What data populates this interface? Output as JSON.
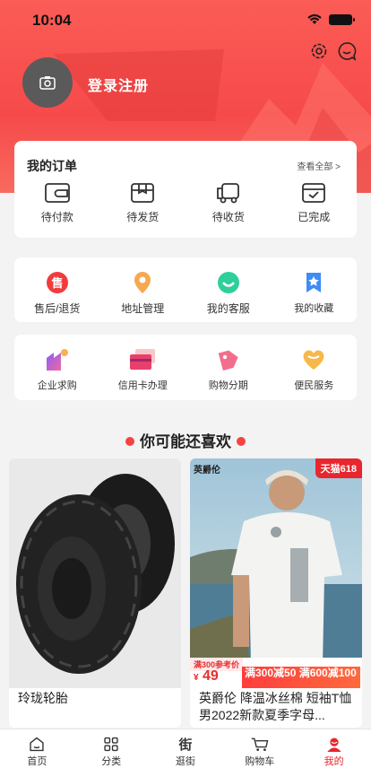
{
  "status_bar": {
    "time": "10:04"
  },
  "profile": {
    "login_label": "登录注册"
  },
  "orders": {
    "title": "我的订单",
    "view_all": "查看全部 >",
    "items": [
      {
        "label": "待付款",
        "icon": "wallet-icon"
      },
      {
        "label": "待发货",
        "icon": "package-icon"
      },
      {
        "label": "待收货",
        "icon": "truck-icon"
      },
      {
        "label": "已完成",
        "icon": "completed-box-icon"
      }
    ]
  },
  "services": [
    {
      "label": "售后/退货",
      "icon": "after-sales-icon",
      "icon_text": "售"
    },
    {
      "label": "地址管理",
      "icon": "location-pin-icon"
    },
    {
      "label": "我的客服",
      "icon": "customer-service-icon"
    },
    {
      "label": "我的收藏",
      "icon": "favorite-star-icon"
    }
  ],
  "more_services": [
    {
      "label": "企业求购",
      "icon": "enterprise-icon"
    },
    {
      "label": "信用卡办理",
      "icon": "credit-card-icon"
    },
    {
      "label": "购物分期",
      "icon": "installment-tag-icon"
    },
    {
      "label": "便民服务",
      "icon": "heart-service-icon"
    }
  ],
  "recommend": {
    "title": "你可能还喜欢"
  },
  "products": [
    {
      "title": "玲珑轮胎"
    },
    {
      "title": "英爵伦 降温冰丝棉 短袖T恤男2022新款夏季字母...",
      "badge": "天猫618",
      "brand": "英爵伦",
      "promo_ref": "满300参考价",
      "price_symbol": "¥",
      "price": "49",
      "promo_line": "满300减50 满600减100"
    }
  ],
  "tabbar": [
    {
      "label": "首页",
      "icon": "home-icon"
    },
    {
      "label": "分类",
      "icon": "category-grid-icon"
    },
    {
      "label": "逛街",
      "icon": "street-icon",
      "icon_text": "街"
    },
    {
      "label": "购物车",
      "icon": "cart-icon"
    },
    {
      "label": "我的",
      "icon": "profile-icon"
    }
  ],
  "colors": {
    "accent": "#e8262d",
    "header": "#f64a4a"
  }
}
